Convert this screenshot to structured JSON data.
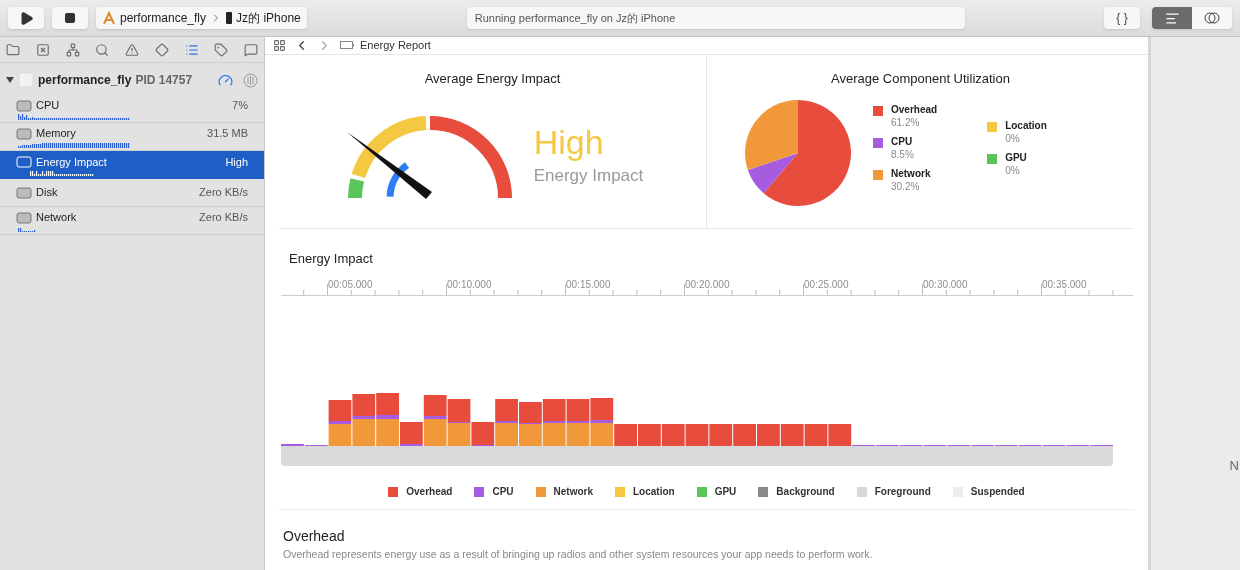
{
  "toolbar": {
    "scheme": "performance_fly",
    "device": "Jz的 iPhone",
    "status": "Running performance_fly on Jz的 iPhone",
    "braces": "{ }",
    "view_modes": [
      {
        "selected": true
      },
      {
        "selected": false
      }
    ]
  },
  "navigator": {
    "tabs": [
      {
        "selected": false
      },
      {
        "selected": false
      },
      {
        "selected": false
      },
      {
        "selected": false
      },
      {
        "selected": false
      },
      {
        "selected": false
      },
      {
        "selected": true
      },
      {
        "selected": false
      },
      {
        "selected": false
      }
    ],
    "process": {
      "name": "performance_fly",
      "pid": "PID 14757",
      "expanded": true
    },
    "gauges": [
      {
        "name": "CPU",
        "value": "7%",
        "selected": false
      },
      {
        "name": "Memory",
        "value": "31.5 MB",
        "selected": false
      },
      {
        "name": "Energy Impact",
        "value": "High",
        "selected": true
      },
      {
        "name": "Disk",
        "value": "Zero KB/s",
        "selected": false
      },
      {
        "name": "Network",
        "value": "Zero KB/s",
        "selected": false
      }
    ]
  },
  "editor": {
    "breadcrumb": "Energy Report",
    "average_energy_impact": {
      "title": "Average Energy Impact",
      "rating": "High",
      "caption": "Energy Impact"
    },
    "component_utilization": {
      "title": "Average Component Utilization",
      "legend": [
        {
          "value": "61.2%",
          "color": "#e84c3d"
        },
        {
          "value": "8.5%",
          "color": "#a55ce0"
        },
        {
          "value": "30.2%",
          "color": "#f0983a"
        },
        {
          "value": "0%",
          "color": "#f5c842"
        },
        {
          "value": "0%",
          "color": "#5ac55a"
        }
      ],
      "chart_data": {
        "type": "pie",
        "categories": [
          "Overhead",
          "CPU",
          "Network",
          "Location",
          "GPU"
        ],
        "values": [
          61.2,
          8.5,
          30.2,
          0,
          0
        ]
      }
    },
    "timeline": {
      "title": "Energy Impact",
      "time_labels": [
        "00:05.000",
        "00:10.000",
        "00:15.000",
        "00:20.000",
        "00:25.000",
        "00:30.000",
        "00:35.000"
      ],
      "legend": [
        {
          "label": "Overhead",
          "color": "#e84c3d"
        },
        {
          "label": "CPU",
          "color": "#a55ce0"
        },
        {
          "label": "Network",
          "color": "#f0983a"
        },
        {
          "label": "Location",
          "color": "#f5c842"
        },
        {
          "label": "GPU",
          "color": "#5ac55a"
        },
        {
          "label": "Background",
          "color": "#8a8a8a"
        },
        {
          "label": "Foreground",
          "color": "#d8d8d8"
        },
        {
          "label": "Suspended",
          "color": "#ececec"
        }
      ]
    },
    "sections": [
      {
        "title": "Overhead",
        "description": "Overhead represents energy use as a result of bringing up radios and other system resources your app needs to perform work."
      }
    ]
  },
  "inspector": {
    "text": "N"
  }
}
